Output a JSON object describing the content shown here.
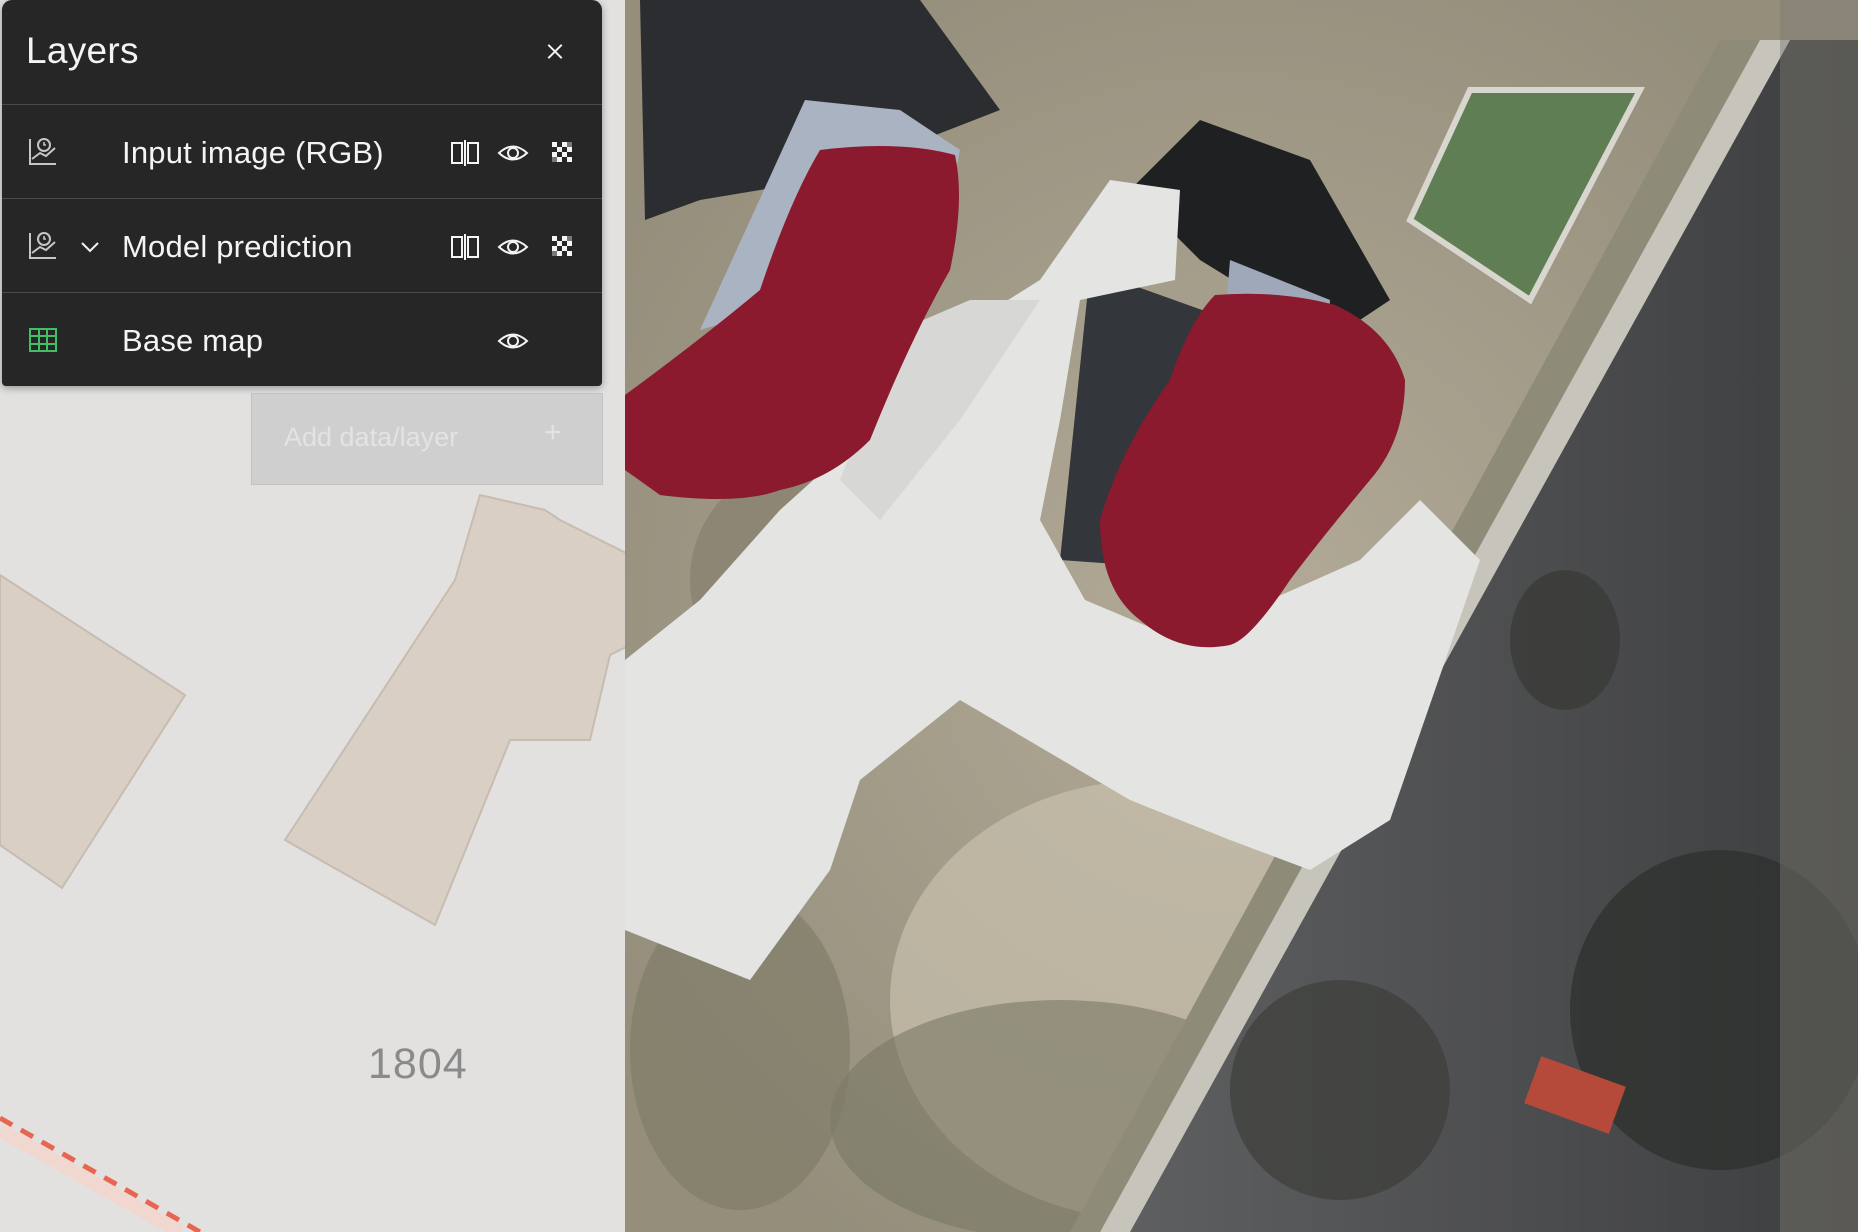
{
  "panel": {
    "title": "Layers",
    "close_icon": "close-icon",
    "layers": [
      {
        "name": "Input image (RGB)",
        "icon": "chart-clock-icon",
        "expandable": false,
        "compare": true,
        "visible": true,
        "opacity_control": true
      },
      {
        "name": "Model prediction",
        "icon": "chart-clock-icon",
        "expandable": true,
        "compare": true,
        "visible": true,
        "opacity_control": true
      },
      {
        "name": "Base map",
        "icon": "map-icon",
        "expandable": false,
        "compare": false,
        "visible": true,
        "opacity_control": false
      }
    ]
  },
  "add_button": {
    "label": "Add data/layer",
    "icon": "plus-icon"
  },
  "map": {
    "street_number": "1804",
    "colors": {
      "basemap_background": "#e2e1e0",
      "building": "#d9cfc5",
      "prediction_overlay": "#8b1a2e",
      "property_line": "#e8664f"
    }
  }
}
